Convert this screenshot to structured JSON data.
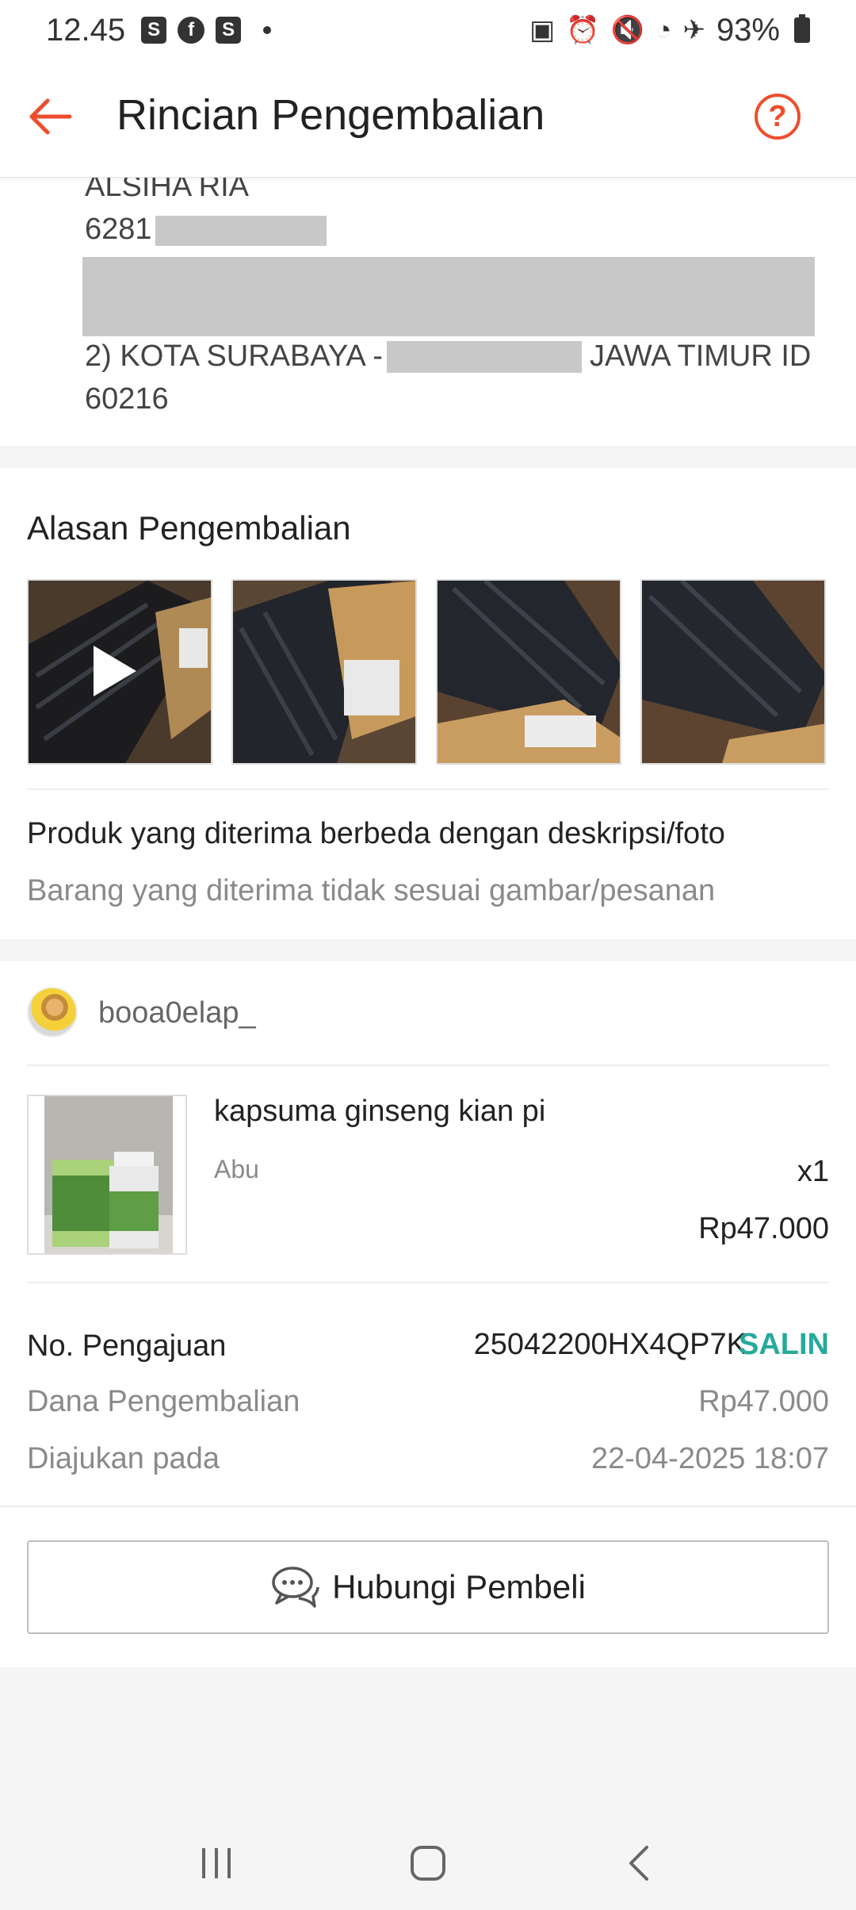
{
  "status_bar": {
    "time": "12.45",
    "left_icons": [
      "shopee-icon",
      "facebook-icon",
      "shopee-icon"
    ],
    "battery": "93%"
  },
  "header": {
    "title": "Rincian Pengembalian",
    "back_icon": "arrow-left-icon",
    "help_icon": "question-circle-icon",
    "help_glyph": "?",
    "accent_color": "#ee4d2d"
  },
  "address": {
    "name": "ALSIHA RIA",
    "phone_prefix": "6281",
    "city_line_prefix": "2) KOTA SURABAYA -",
    "city_line_suffix": "JAWA TIMUR ID",
    "postal_code": "60216"
  },
  "reason": {
    "title": "Alasan Pengembalian",
    "main": "Produk yang diterima berbeda dengan deskripsi/foto",
    "detail": "Barang yang diterima tidak sesuai gambar/pesanan"
  },
  "order": {
    "username": "booa0elap_",
    "product": {
      "name": "kapsuma ginseng kian pi",
      "variant": "Abu",
      "quantity": "x1",
      "price": "Rp47.000"
    },
    "submission": {
      "label": "No. Pengajuan",
      "value": "25042200HX4QP7K",
      "copy_label": "SALIN"
    },
    "refund": {
      "label": "Dana Pengembalian",
      "value": "Rp47.000"
    },
    "submitted": {
      "label": "Diajukan pada",
      "value": "22-04-2025 18:07"
    },
    "contact_button": "Hubungi Pembeli",
    "copy_color": "#26aa99"
  },
  "nav": {
    "recents_icon": "recents-icon",
    "home_icon": "home-icon",
    "back_icon": "back-icon"
  }
}
